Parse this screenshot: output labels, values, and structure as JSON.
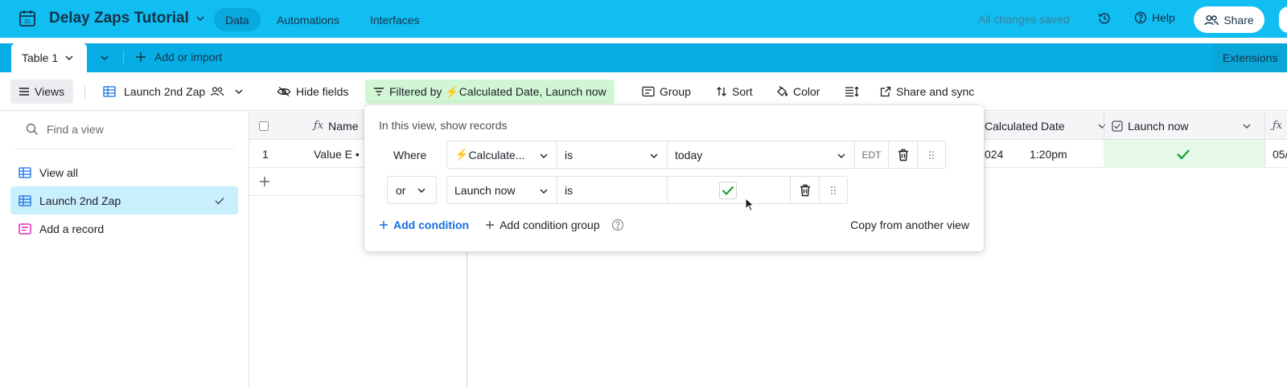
{
  "app": {
    "base_title": "Delay Zaps Tutorial",
    "nav": [
      "Data",
      "Automations",
      "Interfaces"
    ],
    "status": "All changes saved",
    "help_label": "Help",
    "share_label": "Share"
  },
  "tables": {
    "active_tab": "Table 1",
    "add_import": "Add or import",
    "extensions": "Extensions"
  },
  "toolbar": {
    "views": "Views",
    "current_view": "Launch 2nd Zap",
    "hide_fields": "Hide fields",
    "filter_prefix": "Filtered by",
    "filter_fields": "Calculated Date, Launch now",
    "group": "Group",
    "sort": "Sort",
    "color": "Color",
    "share_sync": "Share and sync"
  },
  "sidebar": {
    "find_placeholder": "Find a view",
    "items": [
      "View all",
      "Launch 2nd Zap",
      "Add a record"
    ]
  },
  "grid": {
    "columns": [
      "Name",
      "Calculated Date",
      "Launch now"
    ],
    "row1": {
      "number": "1",
      "name": "Value E •",
      "date_partial": "024",
      "time": "1:20pm",
      "last_partial": "05/"
    }
  },
  "filter_popover": {
    "title": "In this view, show records",
    "row1": {
      "conj": "Where",
      "field": "Calculate...",
      "op": "is",
      "value": "today",
      "tz": "EDT"
    },
    "row2": {
      "conj": "or",
      "field": "Launch now",
      "op": "is"
    },
    "add_condition": "Add condition",
    "add_group": "Add condition group",
    "copy_view": "Copy from another view"
  },
  "colors": {
    "topbar": "#11bef1",
    "tabbar": "#06aee5",
    "filter_active": "#d1f6d4",
    "view_selected": "#c9eefc",
    "check_green": "#20a13b",
    "link_blue": "#166ee1"
  }
}
